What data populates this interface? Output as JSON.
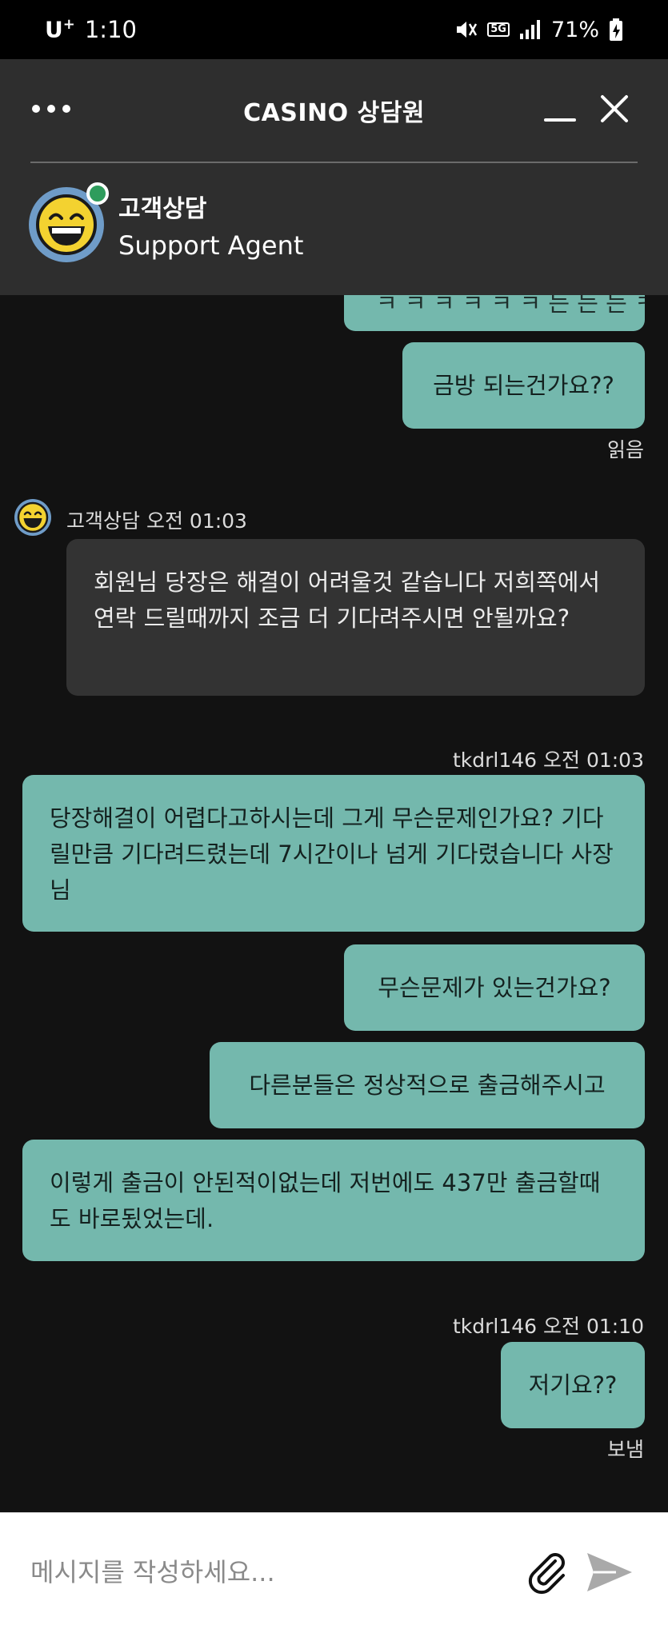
{
  "status_bar": {
    "carrier": "U",
    "carrier_sup": "+",
    "time": "1:10",
    "network": "5G",
    "battery": "71%"
  },
  "header": {
    "title": "CASINO 상담원",
    "agent_name": "고객상담",
    "agent_role": "Support Agent"
  },
  "messages": [
    {
      "id": "m0",
      "side": "right",
      "text": "ㅋ ㅋ ㅋ ㅋ ㅋ ㅋ 는 는 는 ㅋ"
    },
    {
      "id": "m1",
      "side": "right",
      "text": "금방 되는건가요??"
    },
    {
      "id": "m1_status",
      "text": "읽음"
    },
    {
      "id": "m2_meta",
      "sender": "고객상담",
      "time": "오전 01:03"
    },
    {
      "id": "m2",
      "side": "left",
      "text": "회원님 당장은 해결이 어려울것 같습니다 저희쪽에서 연락 드릴때까지 조금 더 기다려주시면 안될까요?"
    },
    {
      "id": "m3_meta",
      "sender": "tkdrl146",
      "time": "오전 01:03"
    },
    {
      "id": "m3",
      "side": "right",
      "text": "당장해결이 어렵다고하시는데 그게 무슨문제인가요? 기다릴만큼 기다려드렸는데 7시간이나 넘게 기다렸습니다 사장님"
    },
    {
      "id": "m4",
      "side": "right",
      "text": "무슨문제가 있는건가요?"
    },
    {
      "id": "m5",
      "side": "right",
      "text": "다른분들은 정상적으로 출금해주시고"
    },
    {
      "id": "m6",
      "side": "right",
      "text": "이렇게 출금이 안된적이없는데 저번에도 437만 출금할때도 바로됬었는데."
    },
    {
      "id": "m7_meta",
      "sender": "tkdrl146",
      "time": "오전 01:10"
    },
    {
      "id": "m7",
      "side": "right",
      "text": "저기요??"
    },
    {
      "id": "m7_status",
      "text": "보냄"
    }
  ],
  "input": {
    "placeholder": "메시지를 작성하세요..."
  },
  "icons": {
    "more": "more-icon",
    "minimize": "minimize-icon",
    "close": "close-icon",
    "attach": "paperclip-icon",
    "send": "send-icon",
    "avatar": "laughing-face-icon"
  },
  "colors": {
    "user_bubble": "#74b8ad",
    "agent_bubble": "#333333",
    "header_bg": "#2e2e2e",
    "online": "#2e9c5c"
  }
}
